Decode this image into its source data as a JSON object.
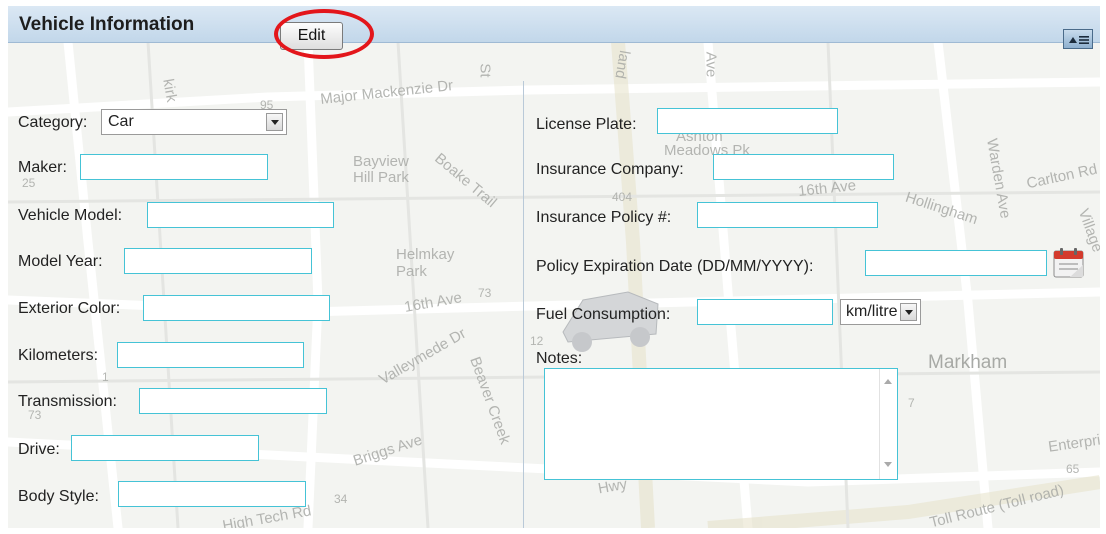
{
  "header": {
    "title": "Vehicle Information",
    "edit_label": "Edit"
  },
  "map_labels": [
    {
      "id": "kirk",
      "text": "kirk"
    },
    {
      "id": "mackenzie",
      "text": "Major Mackenzie Dr"
    },
    {
      "id": "st",
      "text": "St"
    },
    {
      "id": "land",
      "text": "land"
    },
    {
      "id": "ave",
      "text": "Ave"
    },
    {
      "id": "ashton",
      "text": "Ashton"
    },
    {
      "id": "meadows",
      "text": "Meadows Pk"
    },
    {
      "id": "bayview_hill",
      "text": "Bayview Hill Park"
    },
    {
      "id": "boake",
      "text": "Boake Trail"
    },
    {
      "id": "sixteenth1",
      "text": "16th Ave"
    },
    {
      "id": "hollingham",
      "text": "Hollingham"
    },
    {
      "id": "warden",
      "text": "Warden Ave"
    },
    {
      "id": "carlton",
      "text": "Carlton Rd"
    },
    {
      "id": "village",
      "text": "Village"
    },
    {
      "id": "helmkay",
      "text": "Helmkay Park"
    },
    {
      "id": "sixteenth2",
      "text": "16th Ave"
    },
    {
      "id": "valleymede",
      "text": "Valleymede Dr"
    },
    {
      "id": "beaver",
      "text": "Beaver Creek"
    },
    {
      "id": "briggs",
      "text": "Briggs Ave"
    },
    {
      "id": "markham",
      "text": "Markham"
    },
    {
      "id": "enterprise",
      "text": "Enterprise"
    },
    {
      "id": "tollroad",
      "text": "Toll Route (Toll road)"
    },
    {
      "id": "hightech",
      "text": "High Tech Rd"
    },
    {
      "id": "hwy",
      "text": "Hwy"
    },
    {
      "id": "n25",
      "text": "25"
    },
    {
      "id": "n95",
      "text": "95"
    },
    {
      "id": "n404",
      "text": "404"
    },
    {
      "id": "n73a",
      "text": "73"
    },
    {
      "id": "n73b",
      "text": "73"
    },
    {
      "id": "n1",
      "text": "1"
    },
    {
      "id": "n7",
      "text": "7"
    },
    {
      "id": "n34",
      "text": "34"
    },
    {
      "id": "n65",
      "text": "65"
    },
    {
      "id": "n12",
      "text": "12"
    }
  ],
  "left_form": {
    "category": {
      "label": "Category:",
      "value": "Car"
    },
    "maker": {
      "label": "Maker:",
      "value": ""
    },
    "vehicle_model": {
      "label": "Vehicle Model:",
      "value": ""
    },
    "model_year": {
      "label": "Model Year:",
      "value": ""
    },
    "exterior_color": {
      "label": "Exterior Color:",
      "value": ""
    },
    "kilometers": {
      "label": "Kilometers:",
      "value": ""
    },
    "transmission": {
      "label": "Transmission:",
      "value": ""
    },
    "drive": {
      "label": "Drive:",
      "value": ""
    },
    "body_style": {
      "label": "Body Style:",
      "value": ""
    }
  },
  "right_form": {
    "license_plate": {
      "label": "License Plate:",
      "value": ""
    },
    "insurance_company": {
      "label": "Insurance Company:",
      "value": ""
    },
    "insurance_policy": {
      "label": "Insurance Policy #:",
      "value": ""
    },
    "policy_expiration": {
      "label": "Policy Expiration Date (DD/MM/YYYY):",
      "value": ""
    },
    "fuel_consumption": {
      "label": "Fuel Consumption:",
      "value": "",
      "unit": "km/litre"
    },
    "notes": {
      "label": "Notes:",
      "value": ""
    }
  },
  "colors": {
    "header_bg": "#c8dbed",
    "field_border": "#45c3d6",
    "highlight_circle": "#e3161b"
  },
  "icons": {
    "collapse": "collapse-panel-icon",
    "calendar": "calendar-icon"
  }
}
